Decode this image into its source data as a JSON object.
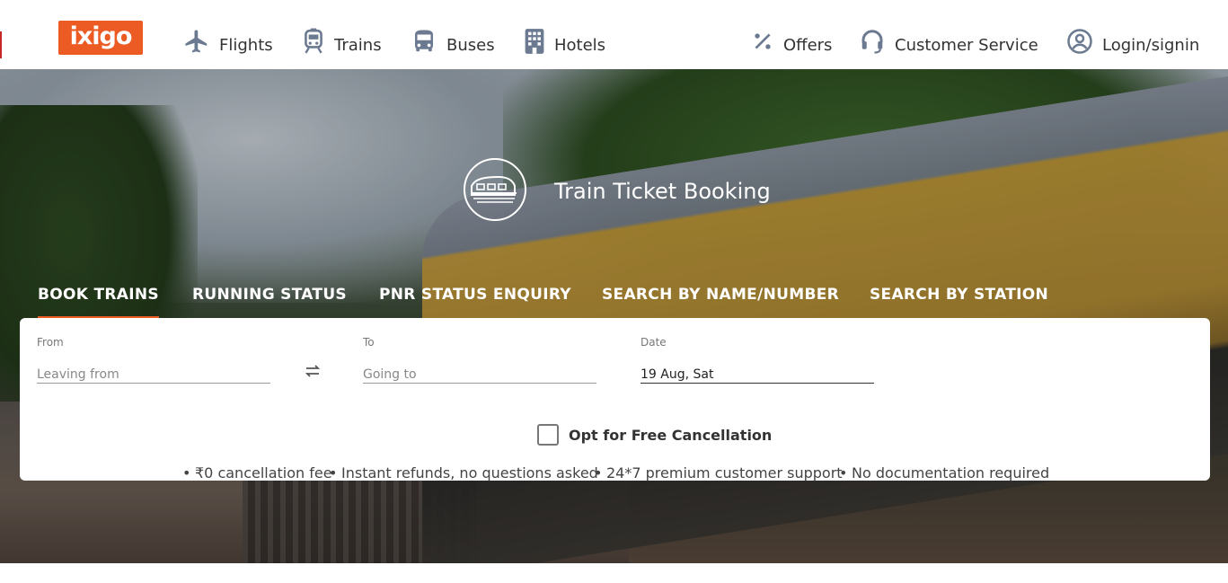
{
  "header": {
    "logo": "ixigo",
    "nav": [
      {
        "label": "Flights",
        "icon": "airplane-icon"
      },
      {
        "label": "Trains",
        "icon": "train-icon"
      },
      {
        "label": "Buses",
        "icon": "bus-icon"
      },
      {
        "label": "Hotels",
        "icon": "hotel-icon"
      }
    ],
    "right_nav": [
      {
        "label": "Offers",
        "icon": "percent-icon"
      },
      {
        "label": "Customer Service",
        "icon": "headset-icon"
      },
      {
        "label": "Login/signin",
        "icon": "user-icon"
      }
    ]
  },
  "hero": {
    "title": "Train Ticket Booking",
    "icon": "train-circle-icon",
    "tabs": [
      {
        "label": "BOOK TRAINS",
        "active": true
      },
      {
        "label": "RUNNING STATUS",
        "active": false
      },
      {
        "label": "PNR STATUS ENQUIRY",
        "active": false
      },
      {
        "label": "SEARCH BY NAME/NUMBER",
        "active": false
      },
      {
        "label": "SEARCH BY STATION",
        "active": false
      }
    ]
  },
  "search": {
    "from": {
      "label": "From",
      "placeholder": "Leaving from",
      "value": ""
    },
    "to": {
      "label": "To",
      "placeholder": "Going to",
      "value": ""
    },
    "date": {
      "label": "Date",
      "value": "19 Aug, Sat"
    },
    "swap_icon": "swap-arrows-icon",
    "free_cancellation": {
      "label": "Opt for Free Cancellation",
      "checked": false
    },
    "benefits": [
      "₹0 cancellation fee",
      "Instant refunds, no questions asked",
      "24*7 premium customer support",
      "No documentation required"
    ]
  },
  "colors": {
    "brand": "#ec5b24",
    "nav_icon": "#6b7a90"
  }
}
